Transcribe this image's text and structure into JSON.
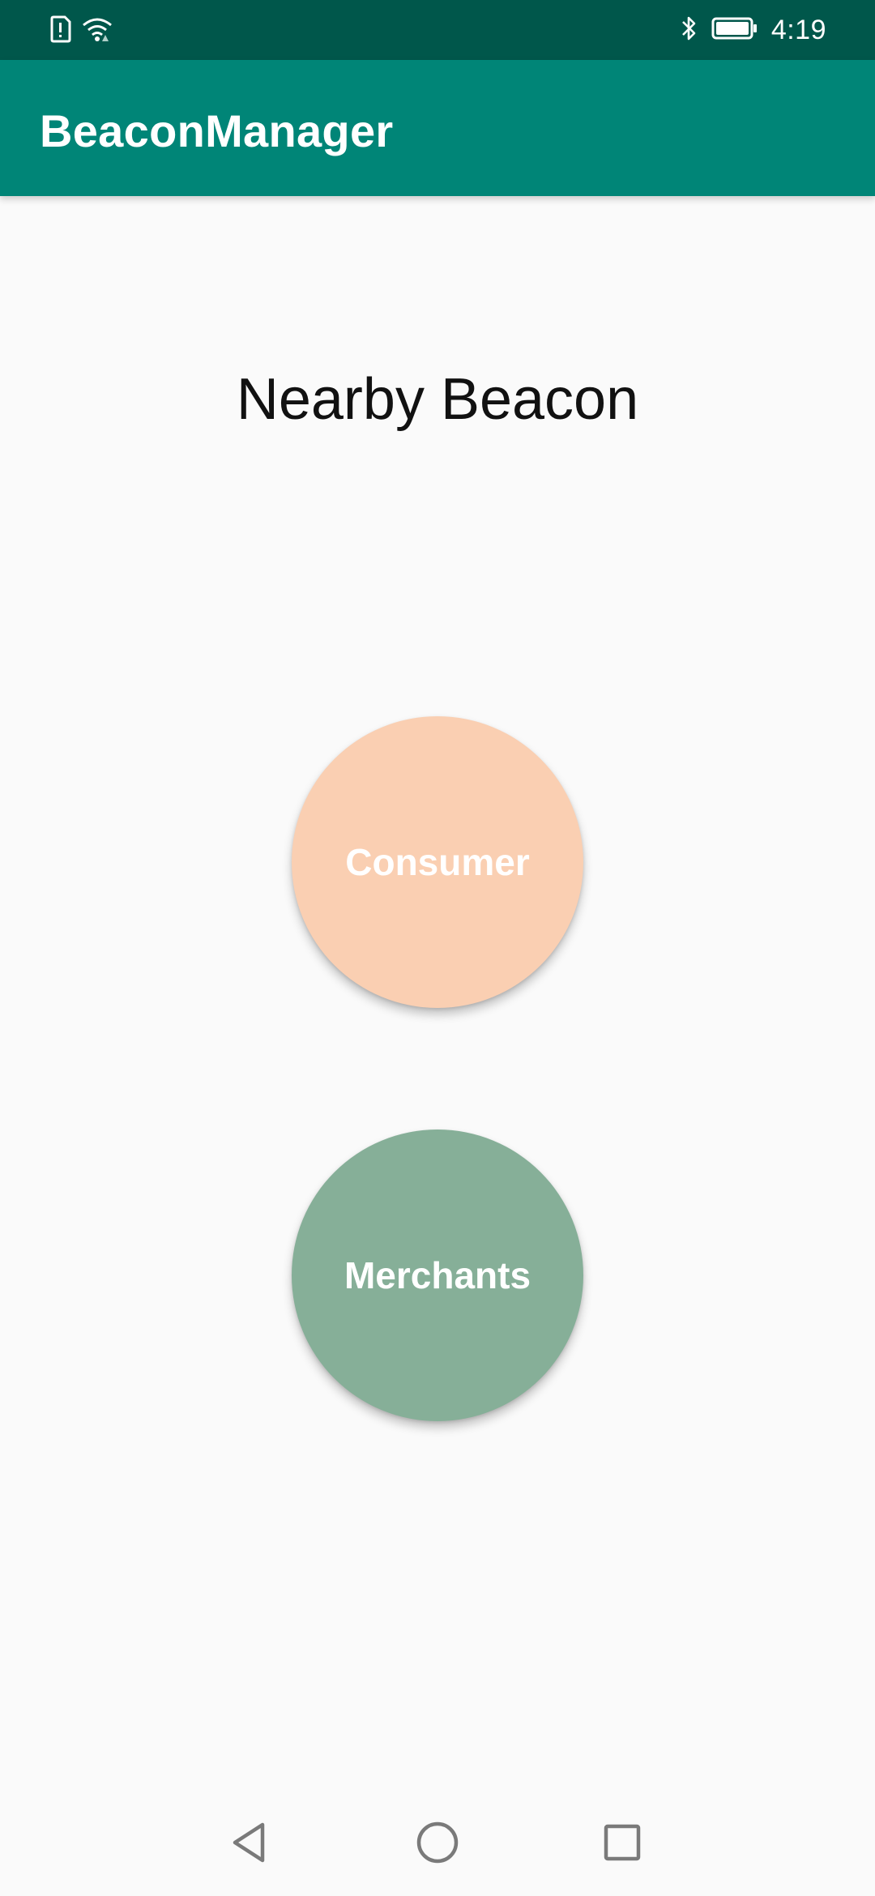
{
  "status_bar": {
    "time": "4:19",
    "icons": [
      "sim-alert-icon",
      "wifi-icon",
      "bluetooth-icon",
      "battery-icon"
    ]
  },
  "app_bar": {
    "title": "BeaconManager"
  },
  "main": {
    "heading": "Nearby Beacon",
    "buttons": [
      {
        "label": "Consumer",
        "color": "#facfb2"
      },
      {
        "label": "Merchants",
        "color": "#86af98"
      }
    ]
  },
  "nav_bar": {
    "icons": [
      "back-icon",
      "home-icon",
      "recents-icon"
    ]
  },
  "colors": {
    "status_bar": "#00574b",
    "app_bar": "#008577",
    "background": "#fafafa"
  }
}
